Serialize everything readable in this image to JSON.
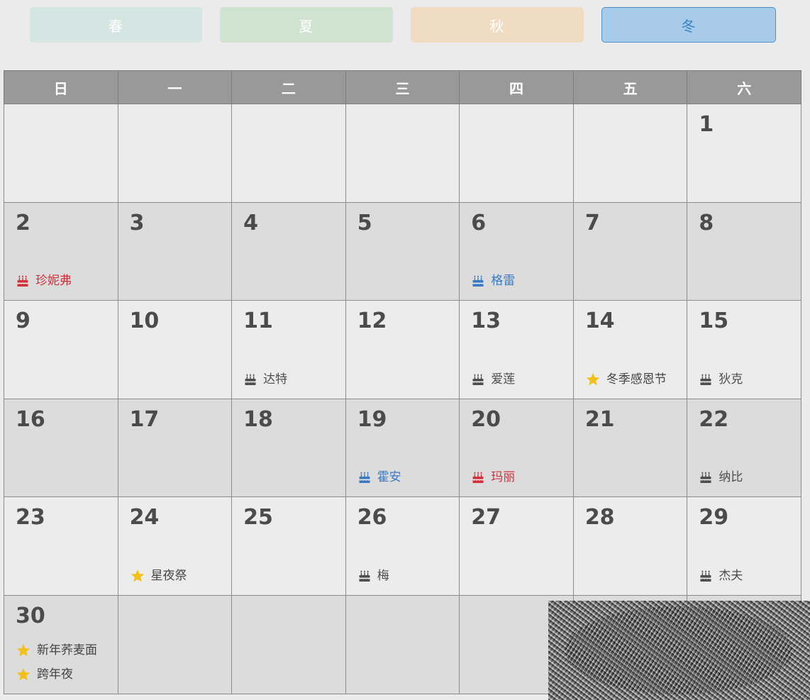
{
  "seasons": [
    {
      "id": "spring",
      "label": "春",
      "active": false
    },
    {
      "id": "summer",
      "label": "夏",
      "active": false
    },
    {
      "id": "fall",
      "label": "秋",
      "active": false
    },
    {
      "id": "winter",
      "label": "冬",
      "active": true
    }
  ],
  "weekdays": [
    "日",
    "一",
    "二",
    "三",
    "四",
    "五",
    "六"
  ],
  "colors": {
    "birthday_red": "#d2323e",
    "birthday_blue": "#3d7ac2",
    "birthday_gray": "#4e4e4e",
    "festival_star": "#f2c01a",
    "header_bg": "#999999"
  },
  "weeks": [
    [
      {
        "day": "",
        "events": []
      },
      {
        "day": "",
        "events": []
      },
      {
        "day": "",
        "events": []
      },
      {
        "day": "",
        "events": []
      },
      {
        "day": "",
        "events": []
      },
      {
        "day": "",
        "events": []
      },
      {
        "day": "1",
        "events": []
      }
    ],
    [
      {
        "day": "2",
        "events": [
          {
            "icon": "cake-icon",
            "color": "red",
            "text": "珍妮弗"
          }
        ]
      },
      {
        "day": "3",
        "events": []
      },
      {
        "day": "4",
        "events": []
      },
      {
        "day": "5",
        "events": []
      },
      {
        "day": "6",
        "events": [
          {
            "icon": "cake-icon",
            "color": "blue",
            "text": "格雷"
          }
        ]
      },
      {
        "day": "7",
        "events": []
      },
      {
        "day": "8",
        "events": []
      }
    ],
    [
      {
        "day": "9",
        "events": []
      },
      {
        "day": "10",
        "events": []
      },
      {
        "day": "11",
        "events": [
          {
            "icon": "cake-icon",
            "color": "gray",
            "text": "达特"
          }
        ]
      },
      {
        "day": "12",
        "events": []
      },
      {
        "day": "13",
        "events": [
          {
            "icon": "cake-icon",
            "color": "gray",
            "text": "爱莲"
          }
        ]
      },
      {
        "day": "14",
        "events": [
          {
            "icon": "star-icon",
            "color": "black",
            "text": "冬季感恩节"
          }
        ]
      },
      {
        "day": "15",
        "events": [
          {
            "icon": "cake-icon",
            "color": "gray",
            "text": "狄克"
          }
        ]
      }
    ],
    [
      {
        "day": "16",
        "events": []
      },
      {
        "day": "17",
        "events": []
      },
      {
        "day": "18",
        "events": []
      },
      {
        "day": "19",
        "events": [
          {
            "icon": "cake-icon",
            "color": "blue",
            "text": "霍安"
          }
        ]
      },
      {
        "day": "20",
        "events": [
          {
            "icon": "cake-icon",
            "color": "red",
            "text": "玛丽"
          }
        ]
      },
      {
        "day": "21",
        "events": []
      },
      {
        "day": "22",
        "events": [
          {
            "icon": "cake-icon",
            "color": "gray",
            "text": "纳比"
          }
        ]
      }
    ],
    [
      {
        "day": "23",
        "events": []
      },
      {
        "day": "24",
        "events": [
          {
            "icon": "star-icon",
            "color": "black",
            "text": "星夜祭"
          }
        ]
      },
      {
        "day": "25",
        "events": []
      },
      {
        "day": "26",
        "events": [
          {
            "icon": "cake-icon",
            "color": "gray",
            "text": "梅"
          }
        ]
      },
      {
        "day": "27",
        "events": []
      },
      {
        "day": "28",
        "events": []
      },
      {
        "day": "29",
        "events": [
          {
            "icon": "cake-icon",
            "color": "gray",
            "text": "杰夫"
          }
        ]
      }
    ],
    [
      {
        "day": "30",
        "events": [
          {
            "icon": "star-icon",
            "color": "black",
            "text": "新年荞麦面"
          },
          {
            "icon": "star-icon",
            "color": "black",
            "text": "跨年夜"
          }
        ]
      },
      {
        "day": "",
        "events": []
      },
      {
        "day": "",
        "events": []
      },
      {
        "day": "",
        "events": []
      },
      {
        "day": "",
        "events": []
      },
      {
        "day": "",
        "events": []
      },
      {
        "day": "",
        "events": []
      }
    ]
  ]
}
